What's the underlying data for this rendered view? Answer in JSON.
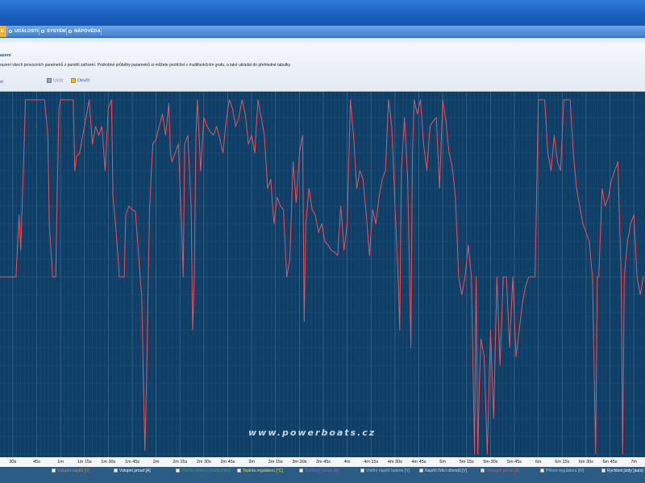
{
  "menu": {
    "tab_active_fragment": "E",
    "tabs": [
      "UDÁLOSTI",
      "SYSTÉM",
      "NÁPOVĚDA"
    ]
  },
  "panel": {
    "title": "azení",
    "description": "razení všech provozních parametrů z paměti zařízení. Podrobné průběhy parametrů si můžete prohlížet v multifunkčním grafu, a také ukládat do přehledné tabulky.",
    "button_left": "st",
    "save_label": "Uložit",
    "open_label": "Otevřít"
  },
  "watermark": "www.powerboats.cz",
  "chart_data": {
    "type": "line",
    "title": "",
    "xlabel": "",
    "ylabel": "",
    "x_ticks": [
      "30s",
      "45s",
      "1m",
      "1m 15s",
      "1m 30s",
      "1m 45s",
      "2m",
      "2m 15s",
      "2m 30s",
      "2m 45s",
      "3m",
      "3m 15s",
      "3m 30s",
      "3m 45s",
      "4m",
      "4m 15s",
      "4m 30s",
      "4m 45s",
      "5m",
      "5m 15s",
      "5m 30s",
      "5m 45s",
      "6m",
      "6m 15s",
      "6m 30s",
      "6m 45s",
      "7m"
    ],
    "x_unit": "seconds",
    "xlim": [
      22,
      427
    ],
    "ylim": [
      -100,
      100
    ],
    "grid": true,
    "series": [
      {
        "color": "#e8545e",
        "points": [
          [
            22,
            0
          ],
          [
            32,
            0
          ],
          [
            34,
            35
          ],
          [
            35,
            15
          ],
          [
            37,
            70
          ],
          [
            38,
            100
          ],
          [
            50,
            100
          ],
          [
            52,
            80
          ],
          [
            53,
            30
          ],
          [
            55,
            0
          ],
          [
            57,
            0
          ],
          [
            58,
            50
          ],
          [
            59,
            95
          ],
          [
            60,
            100
          ],
          [
            68,
            100
          ],
          [
            69,
            60
          ],
          [
            70,
            68
          ],
          [
            72,
            70
          ],
          [
            74,
            80
          ],
          [
            76,
            90
          ],
          [
            78,
            100
          ],
          [
            80,
            75
          ],
          [
            82,
            85
          ],
          [
            84,
            80
          ],
          [
            86,
            85
          ],
          [
            88,
            60
          ],
          [
            90,
            95
          ],
          [
            92,
            100
          ],
          [
            93,
            45
          ],
          [
            95,
            25
          ],
          [
            97,
            0
          ],
          [
            100,
            0
          ],
          [
            101,
            35
          ],
          [
            103,
            40
          ],
          [
            105,
            38
          ],
          [
            107,
            37
          ],
          [
            108,
            25
          ],
          [
            110,
            0
          ],
          [
            111,
            -10
          ],
          [
            112,
            -60
          ],
          [
            113,
            -98
          ],
          [
            114,
            -60
          ],
          [
            115,
            -5
          ],
          [
            116,
            40
          ],
          [
            117,
            60
          ],
          [
            118,
            75
          ],
          [
            120,
            78
          ],
          [
            122,
            85
          ],
          [
            124,
            92
          ],
          [
            126,
            80
          ],
          [
            128,
            98
          ],
          [
            129,
            70
          ],
          [
            130,
            65
          ],
          [
            132,
            70
          ],
          [
            134,
            75
          ],
          [
            136,
            30
          ],
          [
            137,
            0
          ],
          [
            138,
            75
          ],
          [
            140,
            80
          ],
          [
            142,
            40
          ],
          [
            143,
            -30
          ],
          [
            144,
            0
          ],
          [
            145,
            80
          ],
          [
            146,
            100
          ],
          [
            148,
            60
          ],
          [
            150,
            90
          ],
          [
            152,
            85
          ],
          [
            154,
            82
          ],
          [
            156,
            80
          ],
          [
            158,
            85
          ],
          [
            160,
            78
          ],
          [
            162,
            70
          ],
          [
            164,
            88
          ],
          [
            166,
            100
          ],
          [
            168,
            95
          ],
          [
            170,
            85
          ],
          [
            172,
            90
          ],
          [
            174,
            100
          ],
          [
            176,
            92
          ],
          [
            178,
            75
          ],
          [
            180,
            80
          ],
          [
            182,
            70
          ],
          [
            184,
            100
          ],
          [
            186,
            90
          ],
          [
            188,
            80
          ],
          [
            190,
            50
          ],
          [
            192,
            55
          ],
          [
            194,
            30
          ],
          [
            196,
            45
          ],
          [
            198,
            40
          ],
          [
            200,
            38
          ],
          [
            202,
            0
          ],
          [
            204,
            10
          ],
          [
            206,
            65
          ],
          [
            208,
            42
          ],
          [
            210,
            70
          ],
          [
            212,
            80
          ],
          [
            213,
            -25
          ],
          [
            214,
            30
          ],
          [
            216,
            50
          ],
          [
            218,
            38
          ],
          [
            220,
            35
          ],
          [
            222,
            25
          ],
          [
            224,
            30
          ],
          [
            226,
            20
          ],
          [
            228,
            18
          ],
          [
            230,
            15
          ],
          [
            232,
            14
          ],
          [
            234,
            12
          ],
          [
            236,
            40
          ],
          [
            238,
            15
          ],
          [
            240,
            30
          ],
          [
            242,
            100
          ],
          [
            244,
            80
          ],
          [
            246,
            50
          ],
          [
            248,
            60
          ],
          [
            250,
            55
          ],
          [
            252,
            35
          ],
          [
            254,
            12
          ],
          [
            256,
            38
          ],
          [
            258,
            30
          ],
          [
            260,
            45
          ],
          [
            262,
            55
          ],
          [
            264,
            60
          ],
          [
            266,
            100
          ],
          [
            268,
            85
          ],
          [
            270,
            40
          ],
          [
            272,
            0
          ],
          [
            273,
            -30
          ],
          [
            274,
            60
          ],
          [
            276,
            90
          ],
          [
            278,
            55
          ],
          [
            280,
            -40
          ],
          [
            281,
            70
          ],
          [
            282,
            100
          ],
          [
            284,
            92
          ],
          [
            286,
            100
          ],
          [
            288,
            75
          ],
          [
            290,
            60
          ],
          [
            292,
            85
          ],
          [
            294,
            88
          ],
          [
            296,
            90
          ],
          [
            298,
            50
          ],
          [
            300,
            100
          ],
          [
            302,
            88
          ],
          [
            304,
            70
          ],
          [
            306,
            62
          ],
          [
            308,
            45
          ],
          [
            310,
            0
          ],
          [
            312,
            -10
          ],
          [
            314,
            0
          ],
          [
            316,
            18
          ],
          [
            318,
            0
          ],
          [
            320,
            -100
          ],
          [
            321,
            0
          ],
          [
            322,
            -100
          ],
          [
            323,
            -60
          ],
          [
            324,
            -35
          ],
          [
            326,
            -45
          ],
          [
            328,
            -100
          ],
          [
            330,
            -30
          ],
          [
            332,
            -80
          ],
          [
            334,
            0
          ],
          [
            336,
            -50
          ],
          [
            338,
            0
          ],
          [
            340,
            0
          ],
          [
            342,
            -40
          ],
          [
            344,
            0
          ],
          [
            346,
            -45
          ],
          [
            348,
            -30
          ],
          [
            350,
            -15
          ],
          [
            352,
            -5
          ],
          [
            354,
            0
          ],
          [
            356,
            0
          ],
          [
            358,
            0
          ],
          [
            360,
            100
          ],
          [
            364,
            100
          ],
          [
            366,
            70
          ],
          [
            368,
            60
          ],
          [
            370,
            80
          ],
          [
            372,
            65
          ],
          [
            374,
            60
          ],
          [
            376,
            100
          ],
          [
            378,
            100
          ],
          [
            380,
            100
          ],
          [
            382,
            70
          ],
          [
            384,
            50
          ],
          [
            386,
            40
          ],
          [
            388,
            30
          ],
          [
            390,
            25
          ],
          [
            392,
            20
          ],
          [
            394,
            0
          ],
          [
            396,
            -100
          ],
          [
            397,
            0
          ],
          [
            398,
            0
          ],
          [
            400,
            50
          ],
          [
            402,
            40
          ],
          [
            404,
            45
          ],
          [
            406,
            55
          ],
          [
            408,
            60
          ],
          [
            410,
            65
          ],
          [
            412,
            0
          ],
          [
            413,
            -100
          ],
          [
            414,
            0
          ],
          [
            416,
            20
          ],
          [
            418,
            30
          ],
          [
            420,
            35
          ],
          [
            422,
            0
          ],
          [
            424,
            -10
          ],
          [
            426,
            0
          ],
          [
            427,
            0
          ]
        ]
      }
    ],
    "legend": [
      {
        "label": "Vstupní napětí [V]",
        "checked": false,
        "color": "#d98a3a"
      },
      {
        "label": "Vstupní proud [A]",
        "checked": false,
        "color": "#ffffff"
      },
      {
        "label": "Otáčky motoru [otáčky/min]",
        "checked": false,
        "color": "#3fa35b"
      },
      {
        "label": "Teplota regulátoru [°C]",
        "checked": false,
        "color": "#e6e13a"
      },
      {
        "label": "Špičkový proud [A]",
        "checked": false,
        "color": "#8a64c8"
      },
      {
        "label": "Vnitřní napětí baterie [V]",
        "checked": false,
        "color": "#9fc1e0"
      },
      {
        "label": "Napětí řídicí obvodů [V]",
        "checked": false,
        "color": "#d9d9d9"
      },
      {
        "label": "Výstupní proud [A]",
        "checked": true,
        "color": "#e8545e"
      },
      {
        "label": "Příkon regulátoru [W]",
        "checked": false,
        "color": "#9fc1e0"
      },
      {
        "label": "Rychlost jízdy [auto]",
        "checked": false,
        "color": "#ffffff"
      }
    ]
  }
}
